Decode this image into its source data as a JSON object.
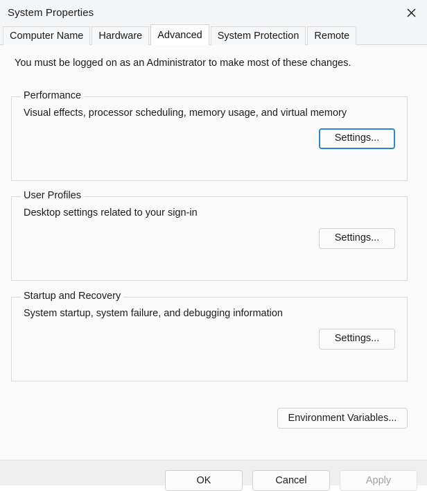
{
  "window": {
    "title": "System Properties",
    "close_icon": "close-icon"
  },
  "tabs": [
    {
      "label": "Computer Name",
      "active": false
    },
    {
      "label": "Hardware",
      "active": false
    },
    {
      "label": "Advanced",
      "active": true
    },
    {
      "label": "System Protection",
      "active": false
    },
    {
      "label": "Remote",
      "active": false
    }
  ],
  "content": {
    "admin_note": "You must be logged on as an Administrator to make most of these changes.",
    "groups": [
      {
        "legend": "Performance",
        "description": "Visual effects, processor scheduling, memory usage, and virtual memory",
        "button_label": "Settings...",
        "button_focused": true
      },
      {
        "legend": "User Profiles",
        "description": "Desktop settings related to your sign-in",
        "button_label": "Settings...",
        "button_focused": false
      },
      {
        "legend": "Startup and Recovery",
        "description": "System startup, system failure, and debugging information",
        "button_label": "Settings...",
        "button_focused": false
      }
    ],
    "environment_variables_label": "Environment Variables..."
  },
  "footer": {
    "ok_label": "OK",
    "cancel_label": "Cancel",
    "apply_label": "Apply",
    "apply_disabled": true
  },
  "colors": {
    "focus_ring": "#2d88d4",
    "titlebar_bg": "#f3f5f7",
    "content_bg": "#fafafa",
    "footer_bg": "#efefef",
    "text": "#1b1b1b",
    "disabled_text": "#a3a3a3"
  }
}
